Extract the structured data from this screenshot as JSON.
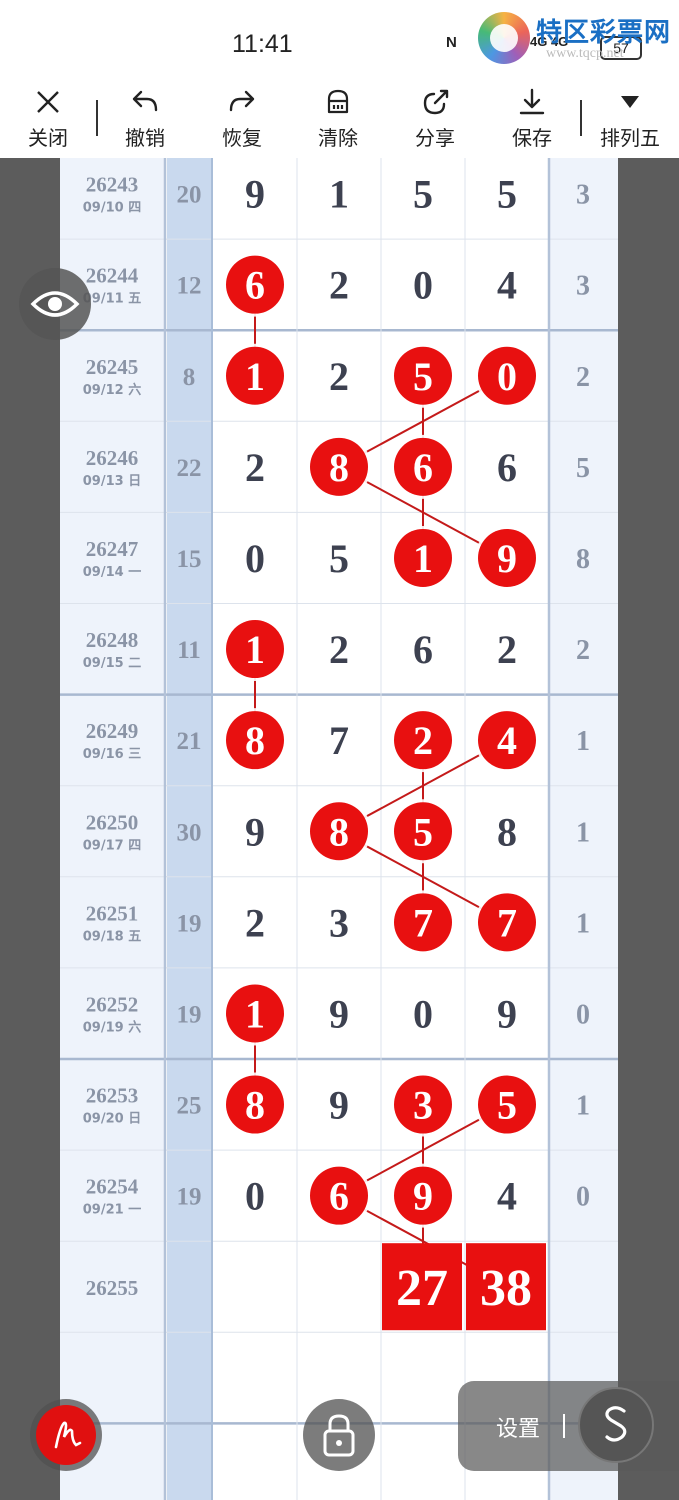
{
  "status_bar": {
    "time": "11:41",
    "nfc": "N",
    "signal_text": "4G 4G",
    "battery": "57"
  },
  "watermark": {
    "text": "特区彩票网",
    "url": "www.tqcp.net"
  },
  "toolbar": {
    "close": "关闭",
    "undo": "撤销",
    "redo": "恢复",
    "clear": "清除",
    "share": "分享",
    "save": "保存",
    "lottery": "排列五"
  },
  "chart": {
    "rows": [
      {
        "issue": "26243",
        "date": "09/10 四",
        "sum": "20",
        "d": [
          "9",
          "1",
          "5",
          "5"
        ],
        "last": "3",
        "hl": [
          false,
          false,
          false,
          false
        ]
      },
      {
        "issue": "26244",
        "date": "09/11 五",
        "sum": "12",
        "d": [
          "6",
          "2",
          "0",
          "4"
        ],
        "last": "3",
        "hl": [
          true,
          false,
          false,
          false
        ]
      },
      {
        "issue": "26245",
        "date": "09/12 六",
        "sum": "8",
        "d": [
          "1",
          "2",
          "5",
          "0"
        ],
        "last": "2",
        "hl": [
          true,
          false,
          true,
          true
        ]
      },
      {
        "issue": "26246",
        "date": "09/13 日",
        "sum": "22",
        "d": [
          "2",
          "8",
          "6",
          "6"
        ],
        "last": "5",
        "hl": [
          false,
          true,
          true,
          false
        ]
      },
      {
        "issue": "26247",
        "date": "09/14 一",
        "sum": "15",
        "d": [
          "0",
          "5",
          "1",
          "9"
        ],
        "last": "8",
        "hl": [
          false,
          false,
          true,
          true
        ]
      },
      {
        "issue": "26248",
        "date": "09/15 二",
        "sum": "11",
        "d": [
          "1",
          "2",
          "6",
          "2"
        ],
        "last": "2",
        "hl": [
          true,
          false,
          false,
          false
        ]
      },
      {
        "issue": "26249",
        "date": "09/16 三",
        "sum": "21",
        "d": [
          "8",
          "7",
          "2",
          "4"
        ],
        "last": "1",
        "hl": [
          true,
          false,
          true,
          true
        ]
      },
      {
        "issue": "26250",
        "date": "09/17 四",
        "sum": "30",
        "d": [
          "9",
          "8",
          "5",
          "8"
        ],
        "last": "1",
        "hl": [
          false,
          true,
          true,
          false
        ]
      },
      {
        "issue": "26251",
        "date": "09/18 五",
        "sum": "19",
        "d": [
          "2",
          "3",
          "7",
          "7"
        ],
        "last": "1",
        "hl": [
          false,
          false,
          true,
          true
        ]
      },
      {
        "issue": "26252",
        "date": "09/19 六",
        "sum": "19",
        "d": [
          "1",
          "9",
          "0",
          "9"
        ],
        "last": "0",
        "hl": [
          true,
          false,
          false,
          false
        ]
      },
      {
        "issue": "26253",
        "date": "09/20 日",
        "sum": "25",
        "d": [
          "8",
          "9",
          "3",
          "5"
        ],
        "last": "1",
        "hl": [
          true,
          false,
          true,
          true
        ]
      },
      {
        "issue": "26254",
        "date": "09/21 一",
        "sum": "19",
        "d": [
          "0",
          "6",
          "9",
          "4"
        ],
        "last": "0",
        "hl": [
          false,
          true,
          true,
          false
        ]
      },
      {
        "issue": "26255",
        "date": "",
        "sum": "",
        "d": [
          "",
          "",
          "",
          ""
        ],
        "last": "",
        "hl": [
          false,
          false,
          false,
          false
        ]
      }
    ],
    "prediction": [
      "27",
      "38"
    ],
    "lines": [
      [
        [
          1,
          0
        ],
        [
          2,
          0
        ]
      ],
      [
        [
          2,
          3
        ],
        [
          3,
          1
        ]
      ],
      [
        [
          2,
          2
        ],
        [
          3,
          2
        ]
      ],
      [
        [
          3,
          2
        ],
        [
          4,
          2
        ]
      ],
      [
        [
          3,
          1
        ],
        [
          4,
          3
        ]
      ],
      [
        [
          5,
          0
        ],
        [
          6,
          0
        ]
      ],
      [
        [
          6,
          3
        ],
        [
          7,
          1
        ]
      ],
      [
        [
          6,
          2
        ],
        [
          7,
          2
        ]
      ],
      [
        [
          7,
          2
        ],
        [
          8,
          2
        ]
      ],
      [
        [
          7,
          1
        ],
        [
          8,
          3
        ]
      ],
      [
        [
          9,
          0
        ],
        [
          10,
          0
        ]
      ],
      [
        [
          10,
          3
        ],
        [
          11,
          1
        ]
      ],
      [
        [
          10,
          2
        ],
        [
          11,
          2
        ]
      ],
      [
        [
          11,
          2
        ],
        [
          12,
          2
        ]
      ],
      [
        [
          11,
          1
        ],
        [
          12,
          3
        ]
      ]
    ],
    "colors": {
      "red": "#e81010",
      "line": "#c41a1a",
      "digit": "#3d4150",
      "meta": "#8a94a6",
      "sum_bg": "#c9d9ee",
      "side_bg": "#eef3fb"
    }
  },
  "controls": {
    "eye": "eye-icon",
    "pen": "pen-icon",
    "lock": "lock-icon",
    "settings_label": "设置",
    "s_button": "S"
  }
}
